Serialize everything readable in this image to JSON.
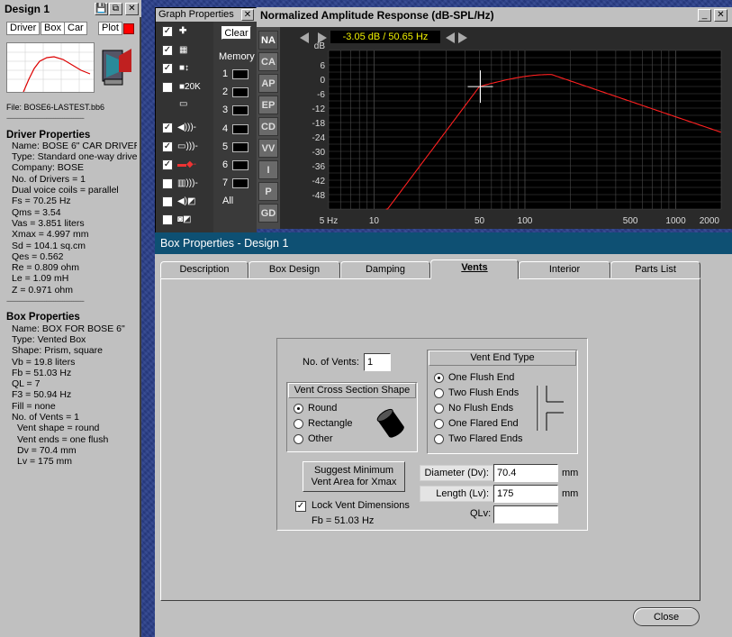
{
  "design": {
    "title": "Design 1",
    "title_buttons": [
      "💾",
      "⧉",
      "✕"
    ],
    "menu": [
      "Driver",
      "Box",
      "Car",
      "Plot"
    ],
    "file": "File: BOSE6-LASTEST.bb6",
    "divider": "-------------------------------------------",
    "driver_heading": "Driver Properties",
    "driver_lines": [
      "Name: BOSE 6\" CAR DRIVER",
      "Type: Standard one-way driver",
      "Company: BOSE",
      "No. of Drivers = 1",
      "Dual voice coils = parallel",
      "Fs = 70.25 Hz",
      "Qms =  3.54",
      "Vas =  3.851 liters",
      "Xmax =  4.997 mm",
      "Sd = 104.1 sq.cm",
      "Qes =  0.562",
      "Re =  0.809 ohm",
      "Le =  1.09 mH",
      "Z =  0.971 ohm"
    ],
    "box_heading": "Box Properties",
    "box_lines": [
      "Name: BOX FOR BOSE 6\"",
      "Type: Vented Box",
      "Shape: Prism, square",
      "Vb = 19.8 liters",
      "Fb = 51.03 Hz",
      "QL = 7",
      "F3 = 50.94 Hz",
      "Fill = none",
      "No. of Vents = 1"
    ],
    "vent_lines": [
      "Vent shape = round",
      "Vent ends = one flush",
      "Dv =  70.4 mm",
      "Lv =  175 mm"
    ]
  },
  "graph_props": {
    "title": "Graph Properties",
    "close": "✕",
    "clear": "Clear",
    "memory": "Memory",
    "memory_slots": [
      "1",
      "2",
      "3",
      "4",
      "5",
      "6",
      "7",
      "All"
    ],
    "checks": [
      true,
      true,
      true,
      false,
      true,
      true,
      true,
      false,
      false,
      false
    ],
    "icon_20k": "20K"
  },
  "graph": {
    "title": "Normalized Amplitude Response (dB-SPL/Hz)",
    "window_buttons": [
      "_",
      "✕"
    ],
    "readout": "-3.05 dB / 50.65 Hz",
    "tabs": [
      "NA",
      "CA",
      "AP",
      "EP",
      "CD",
      "VV",
      "I",
      "P",
      "GD"
    ],
    "y_unit": "dB",
    "y_ticks": [
      "6",
      "0",
      "-6",
      "-12",
      "-18",
      "-24",
      "-30",
      "-36",
      "-42",
      "-48"
    ],
    "x_ticks": [
      "5 Hz",
      "10",
      "50",
      "100",
      "500",
      "1000",
      "2000"
    ],
    "curve_color": "#ff2020"
  },
  "box": {
    "title": "Box Properties - Design 1",
    "tabs": [
      "Description",
      "Box Design",
      "Damping",
      "Vents",
      "Interior",
      "Parts List"
    ],
    "active_tab": "Vents",
    "no_vents_label": "No. of Vents:",
    "no_vents_value": "1",
    "cross_section_header": "Vent Cross Section Shape",
    "shapes": [
      "Round",
      "Rectangle",
      "Other"
    ],
    "shape_selected": 0,
    "end_type_header": "Vent End Type",
    "end_types": [
      "One Flush End",
      "Two Flush Ends",
      "No Flush Ends",
      "One Flared End",
      "Two Flared Ends"
    ],
    "end_selected": 0,
    "suggest_button": "Suggest Minimum Vent Area for Xmax",
    "lock_label": "Lock Vent Dimensions",
    "lock_checked": true,
    "fb_text": "Fb = 51.03 Hz",
    "diameter_label": "Diameter (Dv):",
    "diameter_value": "70.4",
    "length_label": "Length (Lv):",
    "length_value": "175",
    "qlv_label": "QLv:",
    "qlv_value": "",
    "unit": "mm",
    "close_button": "Close"
  }
}
